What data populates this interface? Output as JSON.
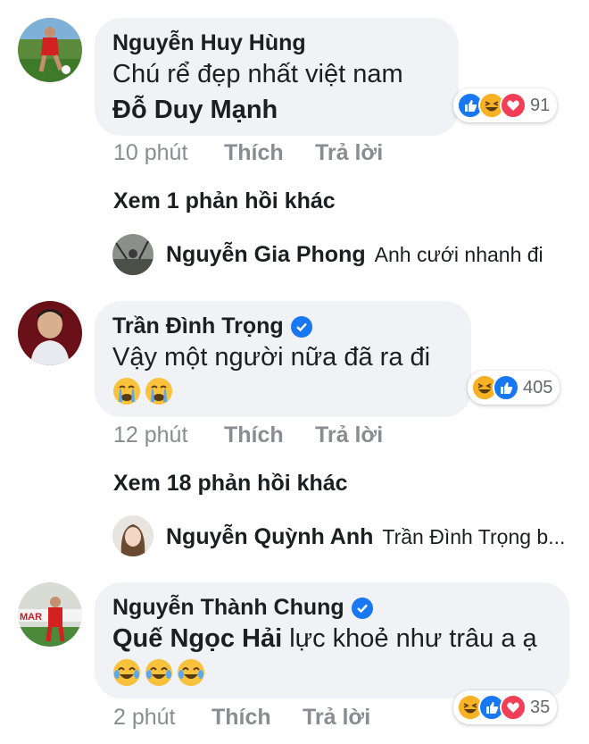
{
  "comments": [
    {
      "author": "Nguyễn Huy Hùng",
      "verified": false,
      "line1": "Chú rể đẹp nhất việt nam",
      "line2_tag": "Đỗ Duy Mạnh",
      "reaction_count": "91",
      "time": "10 phút",
      "like_label": "Thích",
      "reply_label": "Trả lời",
      "more_replies": "Xem 1 phản hồi khác",
      "reply_preview": {
        "author": "Nguyễn Gia Phong",
        "text": "Anh cưới nhanh đi"
      }
    },
    {
      "author": "Trần Đình Trọng",
      "verified": true,
      "line1": "Vậy một người nữa đã ra đi",
      "emoji": [
        "crying-face",
        "crying-face"
      ],
      "reaction_count": "405",
      "time": "12 phút",
      "like_label": "Thích",
      "reply_label": "Trả lời",
      "more_replies": "Xem 18 phản hồi khác",
      "reply_preview": {
        "author": "Nguyễn Quỳnh Anh",
        "text": "Trần Đình Trọng b..."
      }
    },
    {
      "author": "Nguyễn Thành Chung",
      "verified": true,
      "line1_tag": "Quế Ngọc Hải",
      "line1_rest": "lực khoẻ như trâu a ạ",
      "emoji": [
        "tears-of-joy",
        "tears-of-joy",
        "tears-of-joy"
      ],
      "reaction_count": "35",
      "time": "2 phút",
      "like_label": "Thích",
      "reply_label": "Trả lời"
    }
  ],
  "colors": {
    "bubble": "#f0f2f5",
    "meta_text": "#898c91",
    "like_blue": "#1877f2",
    "love_red": "#f33e58",
    "haha_yellow": "#f7b125"
  },
  "avatar_image_text": "MAR"
}
